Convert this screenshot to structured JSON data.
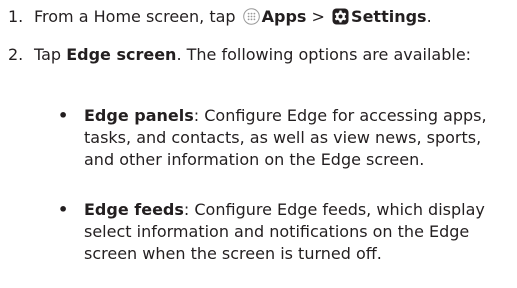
{
  "steps": [
    {
      "number": "1.",
      "prefix": "From a Home screen, tap",
      "apps_label": "Apps",
      "separator": ">",
      "settings_label": "Settings",
      "suffix": ".",
      "icons": [
        "apps-grid-icon",
        "settings-gear-icon"
      ]
    },
    {
      "number": "2.",
      "prefix": "Tap",
      "bold": "Edge screen",
      "suffix": ". The following options are available:"
    }
  ],
  "options": [
    {
      "bullet": "•",
      "title": "Edge panels",
      "text": ": Configure Edge for accessing apps, tasks, and contacts, as well as view news, sports, and other information on the Edge screen."
    },
    {
      "bullet": "•",
      "title": "Edge feeds",
      "text": ": Configure Edge feeds, which display select information and notifications on the Edge screen when the screen is turned off."
    }
  ]
}
